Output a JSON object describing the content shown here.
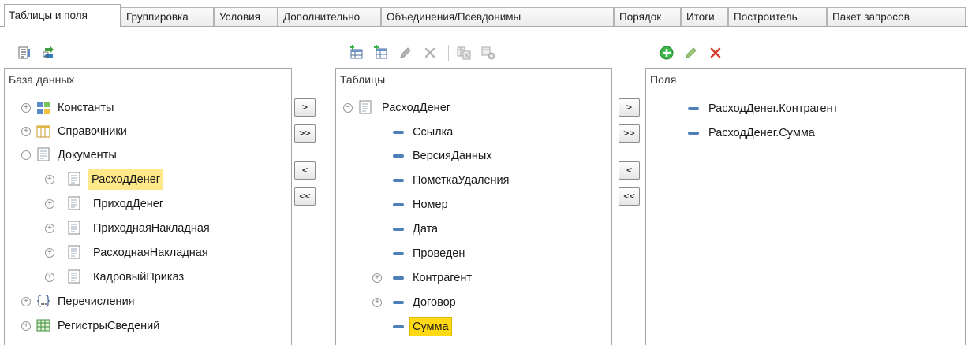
{
  "tabs": [
    {
      "label": "Таблицы и поля",
      "active": true
    },
    {
      "label": "Группировка"
    },
    {
      "label": "Условия"
    },
    {
      "label": "Дополнительно"
    },
    {
      "label": "Объединения/Псевдонимы"
    },
    {
      "label": "Порядок"
    },
    {
      "label": "Итоги"
    },
    {
      "label": "Построитель"
    },
    {
      "label": "Пакет запросов"
    }
  ],
  "database_panel": {
    "header": "База данных",
    "items": [
      {
        "label": "Константы",
        "icon": "constants-icon"
      },
      {
        "label": "Справочники",
        "icon": "catalogs-icon"
      },
      {
        "label": "Документы",
        "icon": "documents-icon",
        "expanded": true
      },
      {
        "label": "РасходДенег",
        "icon": "document-icon",
        "selected": true
      },
      {
        "label": "ПриходДенег",
        "icon": "document-icon"
      },
      {
        "label": "ПриходнаяНакладная",
        "icon": "document-icon"
      },
      {
        "label": "РасходнаяНакладная",
        "icon": "document-icon"
      },
      {
        "label": "КадровыйПриказ",
        "icon": "document-icon"
      },
      {
        "label": "Перечисления",
        "icon": "enums-icon"
      },
      {
        "label": "РегистрыСведений",
        "icon": "info-registers-icon"
      }
    ]
  },
  "tables_panel": {
    "header": "Таблицы",
    "items": [
      {
        "label": "РасходДенег",
        "icon": "document-icon",
        "expanded": true
      },
      {
        "label": "Ссылка",
        "icon": "field-icon"
      },
      {
        "label": "ВерсияДанных",
        "icon": "field-icon"
      },
      {
        "label": "ПометкаУдаления",
        "icon": "field-icon"
      },
      {
        "label": "Номер",
        "icon": "field-icon"
      },
      {
        "label": "Дата",
        "icon": "field-icon"
      },
      {
        "label": "Проведен",
        "icon": "field-icon"
      },
      {
        "label": "Контрагент",
        "icon": "field-icon"
      },
      {
        "label": "Договор",
        "icon": "field-icon"
      },
      {
        "label": "Сумма",
        "icon": "field-icon",
        "selected": true
      }
    ]
  },
  "fields_panel": {
    "header": "Поля",
    "items": [
      {
        "label": "РасходДенег.Контрагент",
        "icon": "field-icon"
      },
      {
        "label": "РасходДенег.Сумма",
        "icon": "field-icon"
      }
    ]
  },
  "transfer_buttons": {
    "add": ">",
    "add_all": ">>",
    "remove": "<",
    "remove_all": "<<"
  },
  "colors": {
    "selection": "#ffe88a",
    "current_selection": "#ffd914",
    "field_icon": "#4d7fb8",
    "delete_red": "#d83a2a",
    "add_green": "#3bb54a"
  }
}
